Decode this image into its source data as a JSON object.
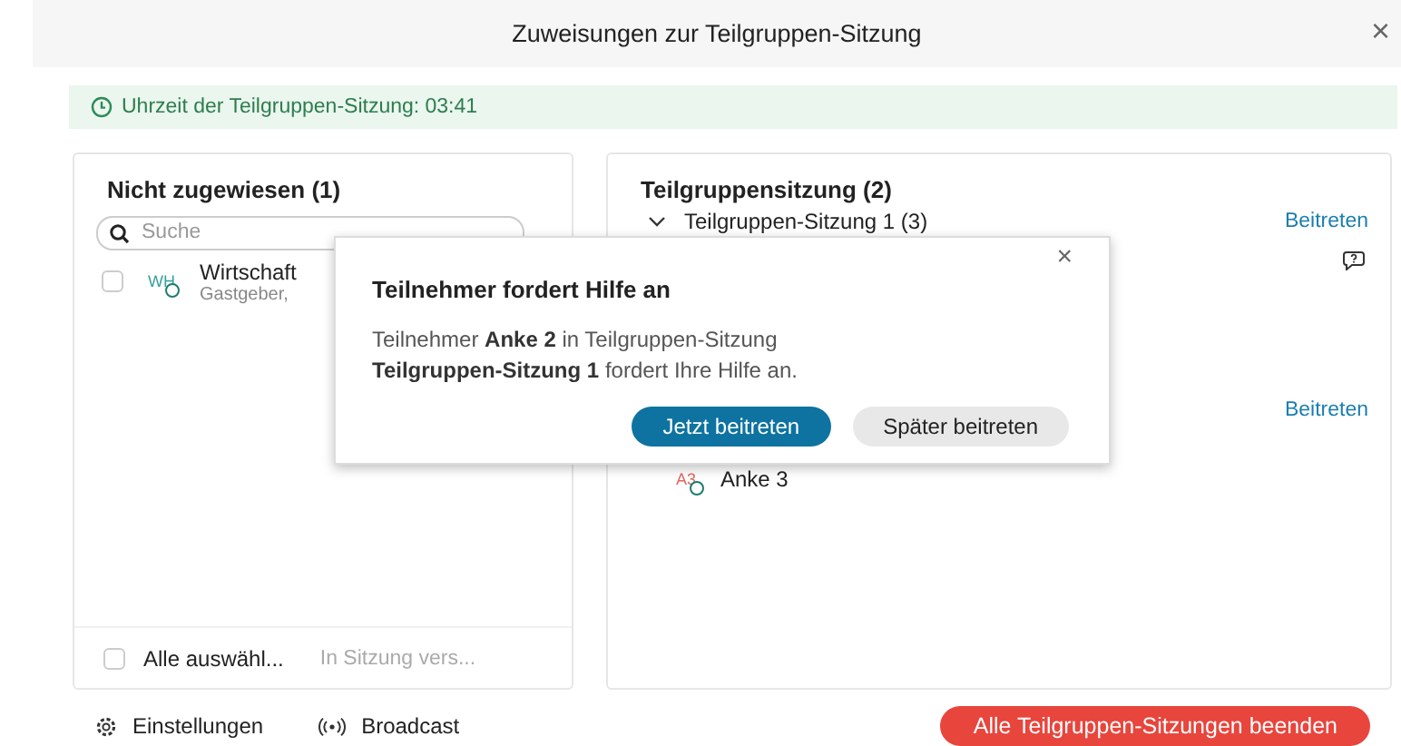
{
  "window": {
    "title": "Zuweisungen zur Teilgruppen-Sitzung",
    "close": "×"
  },
  "timer_banner": {
    "text": "Uhrzeit der Teilgruppen-Sitzung: 03:41"
  },
  "unassigned_panel": {
    "title": "Nicht zugewiesen (1)",
    "search": {
      "placeholder": "Suche"
    },
    "participants": [
      {
        "initials": "WH",
        "name": "Wirtschaft",
        "role": "Gastgeber,",
        "checked": false
      }
    ],
    "select_all": {
      "label": "Alle auswähl...",
      "checked": false
    },
    "move_action": "In Sitzung vers..."
  },
  "sessions_panel": {
    "title": "Teilgruppensitzung  (2)",
    "sessions": [
      {
        "name": "Teilgruppen-Sitzung 1 (3)",
        "expanded": true,
        "join": "Beitreten",
        "help_requested": true
      },
      {
        "join": "Beitreten",
        "participants": [
          {
            "initials": "A3",
            "name": "Anke 3"
          }
        ]
      }
    ]
  },
  "help_dialog": {
    "close": "×",
    "title": "Teilnehmer fordert Hilfe an",
    "message": "Teilnehmer **Anke 2** in Teilgruppen-Sitzung **Teilgruppen-Sitzung 1** fordert Ihre Hilfe an.",
    "buttons": [
      {
        "label": "Jetzt beitreten",
        "kind": "primary"
      },
      {
        "label": "Später beitreten",
        "kind": "secondary"
      }
    ]
  },
  "footer": {
    "settings": "Einstellungen",
    "broadcast": "Broadcast",
    "end_all": "Alle Teilgruppen-Sitzungen beenden"
  }
}
